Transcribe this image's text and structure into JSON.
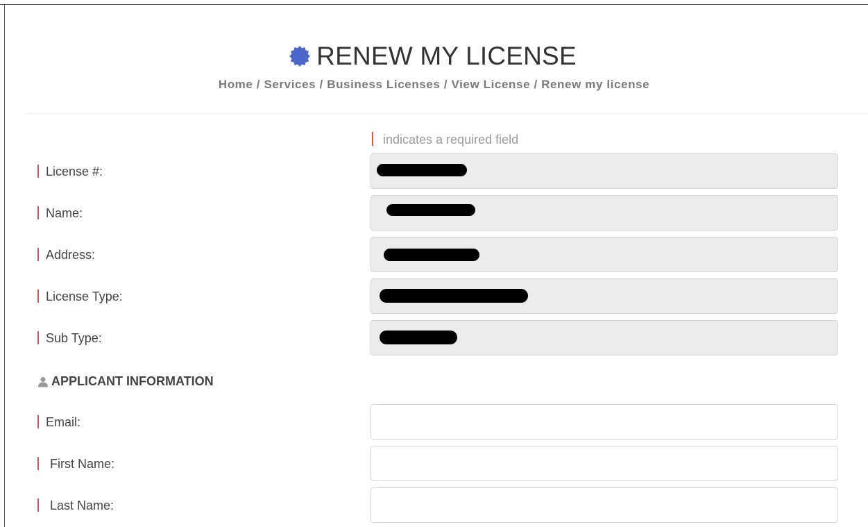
{
  "header": {
    "title": "RENEW MY LICENSE",
    "breadcrumb": [
      "Home",
      "Services",
      "Business Licenses",
      "View License",
      "Renew my license"
    ],
    "separator": " / ",
    "icon": "gear-badge-icon",
    "icon_color": "#4a67c9"
  },
  "required_note": "indicates a required field",
  "accent": "#d9534f",
  "license_fields": [
    {
      "label": "License #:",
      "value": "",
      "redacted": true
    },
    {
      "label": "Name:",
      "value": "",
      "redacted": true
    },
    {
      "label": "Address:",
      "value": "",
      "redacted": true
    },
    {
      "label": "License Type:",
      "value": "",
      "redacted": true
    },
    {
      "label": "Sub Type:",
      "value": "",
      "redacted": true
    }
  ],
  "applicant_section": {
    "title": "APPLICANT INFORMATION",
    "icon": "person-icon",
    "fields": [
      {
        "label": "Email:",
        "value": ""
      },
      {
        "label": "First Name:",
        "value": ""
      },
      {
        "label": "Last Name:",
        "value": ""
      }
    ]
  }
}
